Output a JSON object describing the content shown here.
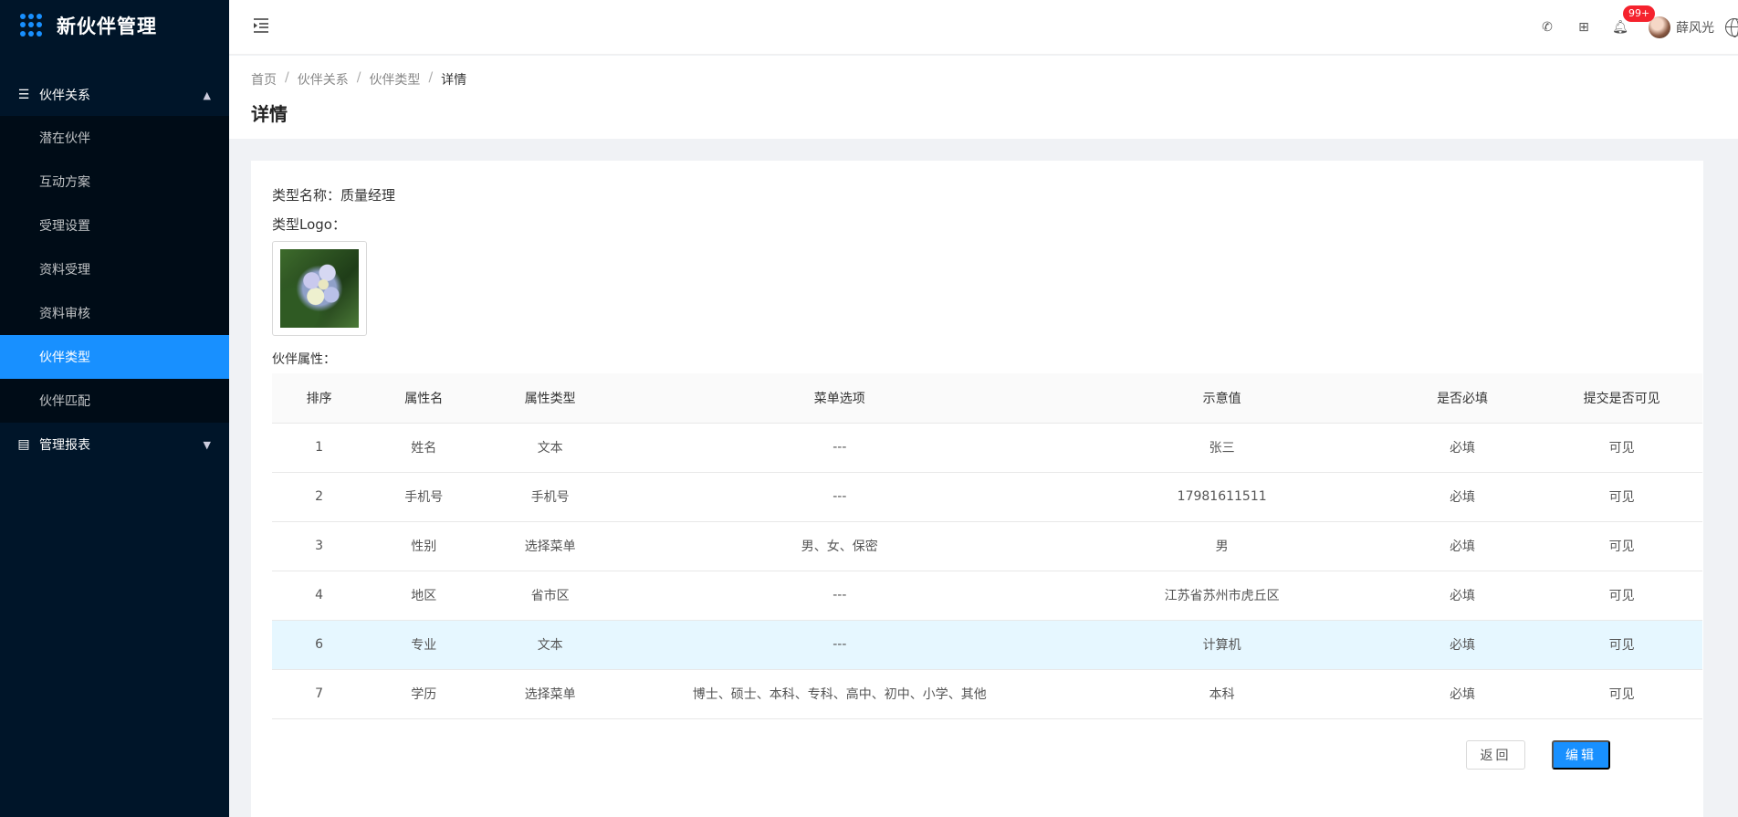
{
  "app": {
    "title": "新伙伴管理"
  },
  "sidebar": {
    "groups": [
      {
        "title": "伙伴关系",
        "icon": "list-icon",
        "expanded": true,
        "items": [
          {
            "label": "潜在伙伴",
            "active": false
          },
          {
            "label": "互动方案",
            "active": false
          },
          {
            "label": "受理设置",
            "active": false
          },
          {
            "label": "资料受理",
            "active": false
          },
          {
            "label": "资料审核",
            "active": false
          },
          {
            "label": "伙伴类型",
            "active": true
          },
          {
            "label": "伙伴匹配",
            "active": false
          }
        ]
      },
      {
        "title": "管理报表",
        "icon": "chart-icon",
        "expanded": false
      }
    ]
  },
  "header": {
    "notifications_badge": "99+",
    "user_name": "薛风光"
  },
  "breadcrumb": [
    "首页",
    "伙伴关系",
    "伙伴类型",
    "详情"
  ],
  "page_title": "详情",
  "detail": {
    "type_name": "类型名称：质量经理",
    "type_logo_label": "类型Logo：",
    "attr_label": "伙伴属性："
  },
  "table": {
    "columns": [
      "排序",
      "属性名",
      "属性类型",
      "菜单选项",
      "示意值",
      "是否必填",
      "提交是否可见"
    ],
    "rows": [
      [
        "1",
        "姓名",
        "文本",
        "---",
        "张三",
        "必填",
        "可见"
      ],
      [
        "2",
        "手机号",
        "手机号",
        "---",
        "17981611511",
        "必填",
        "可见"
      ],
      [
        "3",
        "性别",
        "选择菜单",
        "男、女、保密",
        "男",
        "必填",
        "可见"
      ],
      [
        "4",
        "地区",
        "省市区",
        "---",
        "江苏省苏州市虎丘区",
        "必填",
        "可见"
      ],
      [
        "6",
        "专业",
        "文本",
        "---",
        "计算机",
        "必填",
        "可见"
      ],
      [
        "7",
        "学历",
        "选择菜单",
        "博士、硕士、本科、专科、高中、初中、小学、其他",
        "本科",
        "必填",
        "可见"
      ]
    ]
  },
  "actions": {
    "back_label": "返回",
    "edit_label": "编辑"
  }
}
